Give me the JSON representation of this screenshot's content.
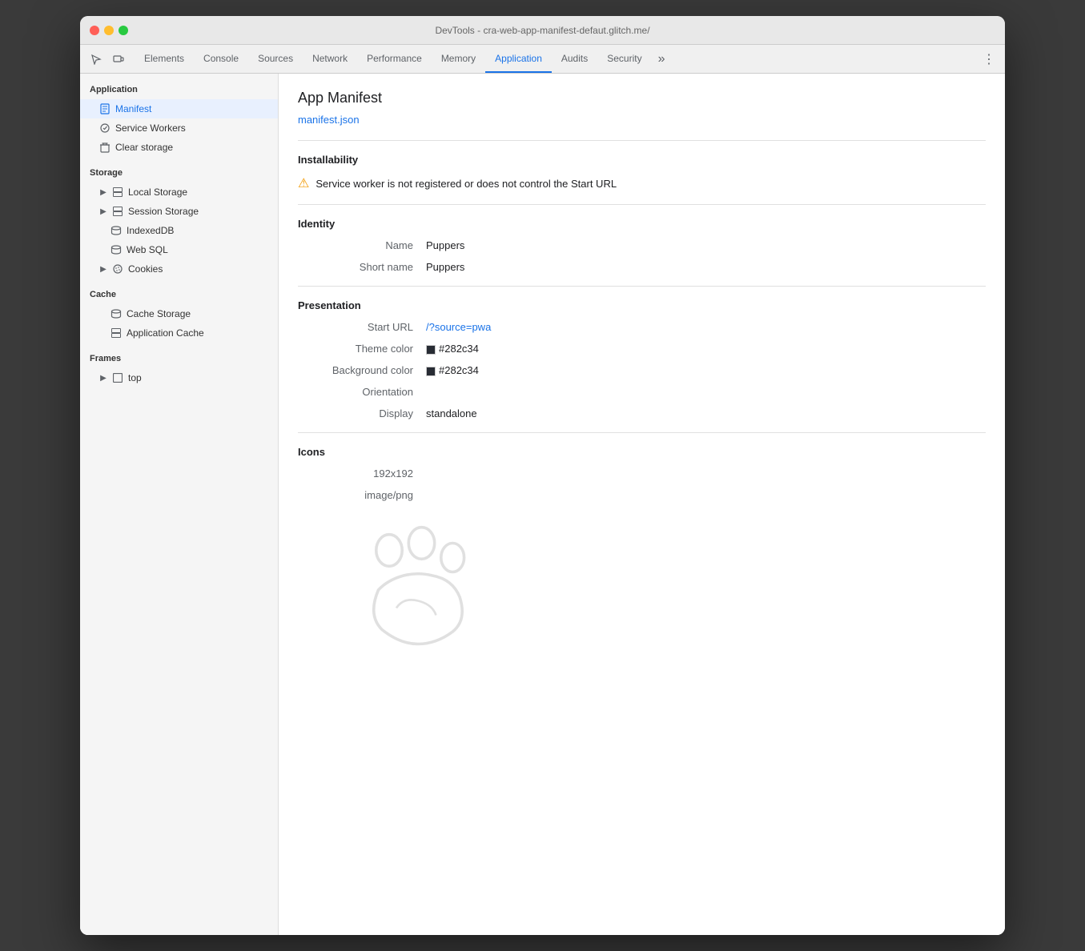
{
  "window": {
    "title": "DevTools - cra-web-app-manifest-defaut.glitch.me/"
  },
  "tabs": {
    "items": [
      {
        "label": "Elements",
        "active": false
      },
      {
        "label": "Console",
        "active": false
      },
      {
        "label": "Sources",
        "active": false
      },
      {
        "label": "Network",
        "active": false
      },
      {
        "label": "Performance",
        "active": false
      },
      {
        "label": "Memory",
        "active": false
      },
      {
        "label": "Application",
        "active": true
      },
      {
        "label": "Audits",
        "active": false
      },
      {
        "label": "Security",
        "active": false
      }
    ],
    "more_label": "»"
  },
  "sidebar": {
    "application_header": "Application",
    "items_application": [
      {
        "label": "Manifest",
        "icon": "doc",
        "active": true
      },
      {
        "label": "Service Workers",
        "icon": "gear",
        "active": false
      },
      {
        "label": "Clear storage",
        "icon": "clear",
        "active": false
      }
    ],
    "storage_header": "Storage",
    "items_storage": [
      {
        "label": "Local Storage",
        "icon": "grid",
        "expandable": true
      },
      {
        "label": "Session Storage",
        "icon": "grid",
        "expandable": true
      },
      {
        "label": "IndexedDB",
        "icon": "db",
        "expandable": false
      },
      {
        "label": "Web SQL",
        "icon": "db",
        "expandable": false
      },
      {
        "label": "Cookies",
        "icon": "cookie",
        "expandable": true
      }
    ],
    "cache_header": "Cache",
    "items_cache": [
      {
        "label": "Cache Storage",
        "icon": "db",
        "expandable": false
      },
      {
        "label": "Application Cache",
        "icon": "grid",
        "expandable": false
      }
    ],
    "frames_header": "Frames",
    "items_frames": [
      {
        "label": "top",
        "icon": "frame",
        "expandable": true
      }
    ]
  },
  "main": {
    "title": "App Manifest",
    "manifest_link": "manifest.json",
    "installability": {
      "section_title": "Installability",
      "warning_text": "Service worker is not registered or does not control the Start URL"
    },
    "identity": {
      "section_title": "Identity",
      "name_label": "Name",
      "name_value": "Puppers",
      "short_name_label": "Short name",
      "short_name_value": "Puppers"
    },
    "presentation": {
      "section_title": "Presentation",
      "start_url_label": "Start URL",
      "start_url_value": "/?source=pwa",
      "theme_color_label": "Theme color",
      "theme_color_value": "#282c34",
      "bg_color_label": "Background color",
      "bg_color_value": "#282c34",
      "orientation_label": "Orientation",
      "orientation_value": "",
      "display_label": "Display",
      "display_value": "standalone"
    },
    "icons": {
      "section_title": "Icons",
      "size_label": "192x192",
      "type_label": "image/png"
    }
  }
}
